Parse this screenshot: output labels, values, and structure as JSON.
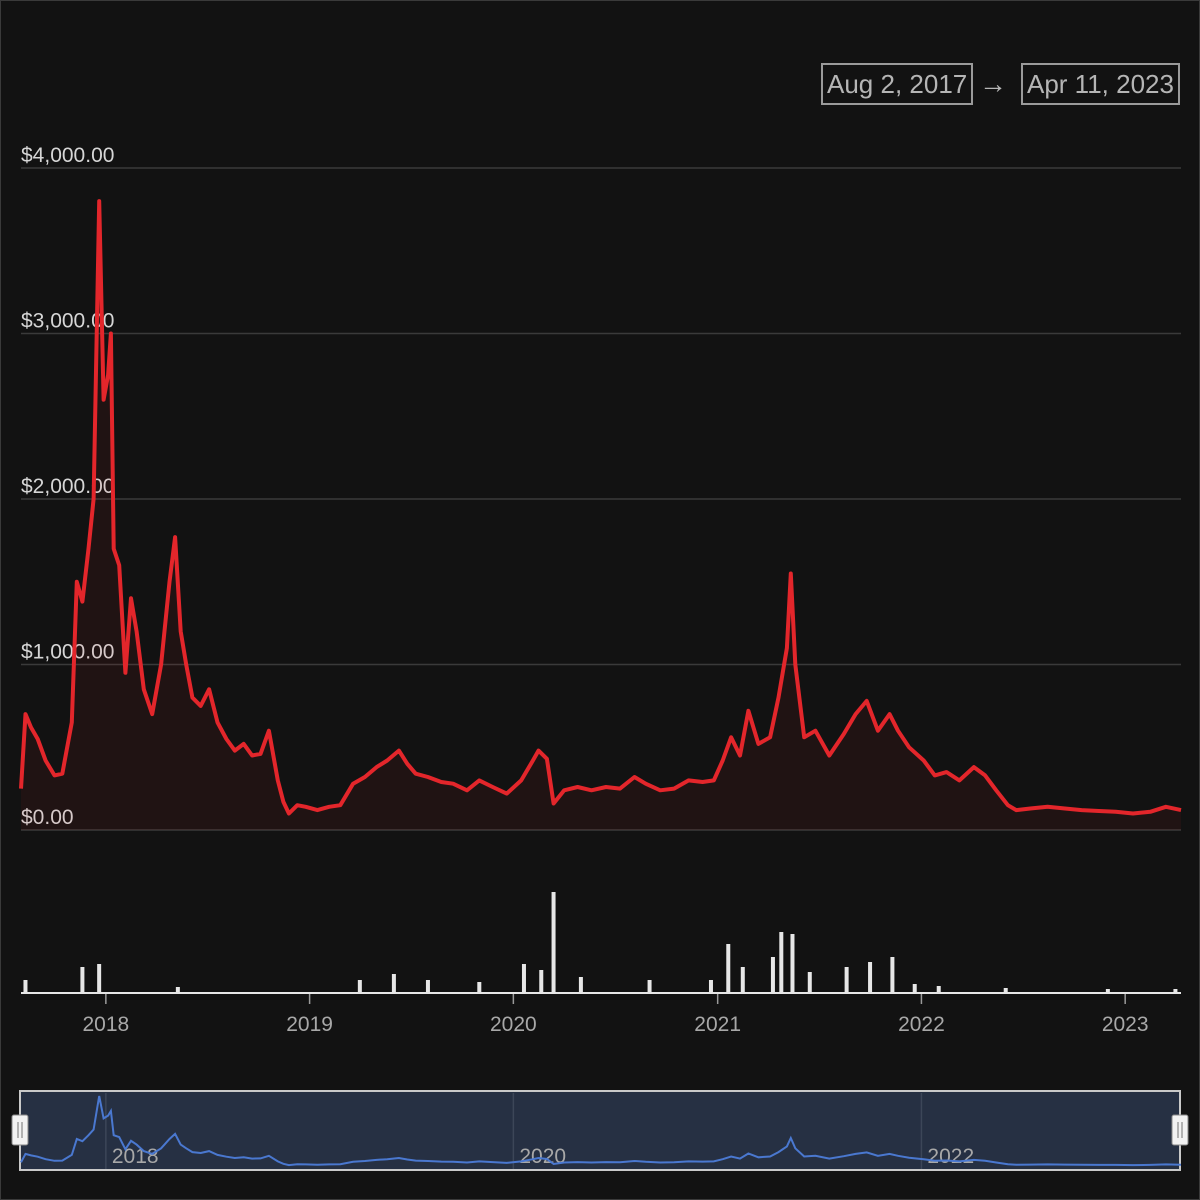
{
  "range_selector": {
    "start_date": "Aug 2, 2017",
    "arrow": "→",
    "end_date": "Apr 11, 2023"
  },
  "colors": {
    "background": "#121212",
    "price_line": "#e3262b",
    "volume_bars": "#ffffff",
    "navigator_line": "#4a78d0",
    "navigator_fill": "#263043"
  },
  "chart_data": {
    "type": "line",
    "title": "",
    "xlabel": "",
    "ylabel": "",
    "x_range": [
      "2017-08-02",
      "2023-04-11"
    ],
    "ylim": [
      0,
      4000
    ],
    "y_tick_labels": [
      "$0.00",
      "$1,000.00",
      "$2,000.00",
      "$3,000.00",
      "$4,000.00"
    ],
    "y_ticks": [
      0,
      1000,
      2000,
      3000,
      4000
    ],
    "x_tick_labels": [
      "2018",
      "2019",
      "2020",
      "2021",
      "2022",
      "2023"
    ],
    "navigator_tick_labels": [
      "2018",
      "2020",
      "2022"
    ],
    "grid": true,
    "series": [
      {
        "type": "line",
        "x": [
          "2017-08-02",
          "2017-08-10",
          "2017-08-20",
          "2017-09-01",
          "2017-09-15",
          "2017-10-01",
          "2017-10-15",
          "2017-11-01",
          "2017-11-10",
          "2017-11-20",
          "2017-12-01",
          "2017-12-10",
          "2017-12-20",
          "2017-12-28",
          "2018-01-05",
          "2018-01-10",
          "2018-01-15",
          "2018-01-25",
          "2018-02-05",
          "2018-02-15",
          "2018-02-25",
          "2018-03-10",
          "2018-03-25",
          "2018-04-10",
          "2018-04-25",
          "2018-05-05",
          "2018-05-15",
          "2018-05-25",
          "2018-06-05",
          "2018-06-20",
          "2018-07-05",
          "2018-07-20",
          "2018-08-05",
          "2018-08-20",
          "2018-09-05",
          "2018-09-20",
          "2018-10-05",
          "2018-10-20",
          "2018-11-05",
          "2018-11-15",
          "2018-11-25",
          "2018-12-10",
          "2018-12-25",
          "2019-01-15",
          "2019-02-05",
          "2019-02-25",
          "2019-03-20",
          "2019-04-10",
          "2019-05-01",
          "2019-05-20",
          "2019-06-10",
          "2019-06-25",
          "2019-07-10",
          "2019-08-01",
          "2019-08-25",
          "2019-09-15",
          "2019-10-10",
          "2019-11-01",
          "2019-11-25",
          "2019-12-20",
          "2020-01-15",
          "2020-02-05",
          "2020-02-15",
          "2020-03-01",
          "2020-03-13",
          "2020-04-01",
          "2020-04-25",
          "2020-05-20",
          "2020-06-15",
          "2020-07-10",
          "2020-08-05",
          "2020-08-25",
          "2020-09-20",
          "2020-10-15",
          "2020-11-10",
          "2020-12-05",
          "2020-12-25",
          "2021-01-10",
          "2021-01-25",
          "2021-02-10",
          "2021-02-25",
          "2021-03-15",
          "2021-04-05",
          "2021-04-20",
          "2021-05-05",
          "2021-05-12",
          "2021-05-20",
          "2021-06-05",
          "2021-06-25",
          "2021-07-20",
          "2021-08-15",
          "2021-09-05",
          "2021-09-25",
          "2021-10-15",
          "2021-11-05",
          "2021-11-20",
          "2021-12-10",
          "2022-01-05",
          "2022-01-25",
          "2022-02-15",
          "2022-03-10",
          "2022-04-05",
          "2022-04-25",
          "2022-05-15",
          "2022-06-05",
          "2022-06-20",
          "2022-07-15",
          "2022-08-15",
          "2022-09-15",
          "2022-10-15",
          "2022-11-15",
          "2022-12-15",
          "2023-01-15",
          "2023-02-15",
          "2023-03-15",
          "2023-04-11"
        ],
        "values": [
          250,
          700,
          620,
          550,
          420,
          330,
          340,
          650,
          1500,
          1380,
          1700,
          2000,
          3800,
          2600,
          2750,
          3000,
          1700,
          1600,
          950,
          1400,
          1200,
          850,
          700,
          1000,
          1500,
          1770,
          1200,
          1000,
          800,
          750,
          850,
          650,
          550,
          480,
          520,
          450,
          460,
          600,
          300,
          170,
          100,
          150,
          140,
          120,
          140,
          150,
          280,
          320,
          380,
          420,
          480,
          400,
          340,
          320,
          290,
          280,
          240,
          300,
          260,
          220,
          300,
          420,
          480,
          430,
          160,
          240,
          260,
          240,
          260,
          250,
          320,
          280,
          240,
          250,
          300,
          290,
          300,
          420,
          560,
          450,
          720,
          520,
          560,
          800,
          1100,
          1550,
          1000,
          560,
          600,
          450,
          580,
          700,
          780,
          600,
          700,
          600,
          500,
          420,
          330,
          350,
          300,
          380,
          330,
          240,
          150,
          120,
          130,
          140,
          130,
          120,
          115,
          110,
          100,
          110,
          140,
          120
        ]
      }
    ],
    "volume_series": {
      "type": "bar",
      "note_unit": "relative",
      "x": [
        "2017-08-10",
        "2017-11-20",
        "2017-12-20",
        "2018-05-10",
        "2019-04-01",
        "2019-06-01",
        "2019-08-01",
        "2019-11-01",
        "2020-01-20",
        "2020-02-20",
        "2020-03-13",
        "2020-05-01",
        "2020-09-01",
        "2020-12-20",
        "2021-01-20",
        "2021-02-15",
        "2021-04-10",
        "2021-04-25",
        "2021-05-15",
        "2021-06-15",
        "2021-08-20",
        "2021-10-01",
        "2021-11-10",
        "2021-12-20",
        "2022-02-01",
        "2022-06-01",
        "2022-12-01",
        "2023-04-01"
      ],
      "values": [
        0.12,
        0.25,
        0.28,
        0.05,
        0.12,
        0.18,
        0.12,
        0.1,
        0.28,
        0.22,
        1.0,
        0.15,
        0.12,
        0.12,
        0.48,
        0.25,
        0.35,
        0.6,
        0.58,
        0.2,
        0.25,
        0.3,
        0.35,
        0.08,
        0.06,
        0.04,
        0.03,
        0.03
      ]
    }
  }
}
